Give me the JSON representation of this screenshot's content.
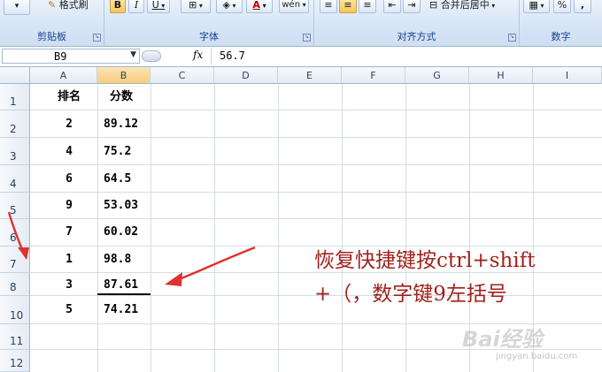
{
  "ribbon": {
    "groups": [
      {
        "label": "剪贴板",
        "buttons": [
          "格式刷"
        ]
      },
      {
        "label": "字体",
        "buttons": [
          "B",
          "I",
          "U",
          "A",
          "wén"
        ]
      },
      {
        "label": "对齐方式",
        "buttons": [
          "合并后居中"
        ]
      },
      {
        "label": "数字",
        "buttons": [
          "%",
          ","
        ]
      }
    ]
  },
  "formula_bar": {
    "name_box": "B9",
    "fx_label": "fx",
    "value": "56.7"
  },
  "grid": {
    "columns": [
      "A",
      "B",
      "C",
      "D",
      "E",
      "F",
      "G",
      "H",
      "I"
    ],
    "selected_column": "B",
    "rows": [
      "1",
      "2",
      "3",
      "4",
      "5",
      "6",
      "7",
      "8",
      "10",
      "11",
      "12"
    ],
    "header_row": {
      "A": "排名",
      "B": "分数"
    },
    "data_rows": [
      {
        "rank": "2",
        "score": "89.12"
      },
      {
        "rank": "4",
        "score": "75.2"
      },
      {
        "rank": "6",
        "score": "64.5"
      },
      {
        "rank": "9",
        "score": "53.03"
      },
      {
        "rank": "7",
        "score": "60.02"
      },
      {
        "rank": "1",
        "score": "98.8"
      },
      {
        "rank": "3",
        "score": "87.61"
      },
      {
        "rank": "5",
        "score": "74.21"
      }
    ]
  },
  "annotation": {
    "line1": "恢复快捷键按ctrl+shift",
    "line2": "+（，数字键9左括号",
    "color": "#a0231d"
  },
  "watermark": {
    "brand": "Bai经验",
    "url": "jingyan.baidu.com"
  },
  "colors": {
    "ribbon_bg": "#d6e4f5",
    "selected_header": "#f8cd7a",
    "arrow": "#e03030"
  }
}
